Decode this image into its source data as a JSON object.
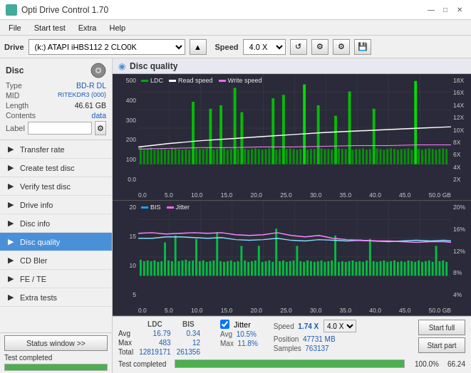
{
  "app": {
    "title": "Opti Drive Control 1.70",
    "icon_color": "#4a9a6a"
  },
  "titlebar": {
    "title": "Opti Drive Control 1.70",
    "minimize": "—",
    "maximize": "□",
    "close": "✕"
  },
  "menubar": {
    "items": [
      "File",
      "Start test",
      "Extra",
      "Help"
    ]
  },
  "toolbar": {
    "drive_label": "Drive",
    "drive_value": "(k:) ATAPI iHBS112  2 CLO0K",
    "speed_label": "Speed",
    "speed_value": "4.0 X"
  },
  "disc": {
    "section_title": "Disc",
    "type_label": "Type",
    "type_value": "BD-R DL",
    "mid_label": "MID",
    "mid_value": "RITEKDR3 (000)",
    "length_label": "Length",
    "length_value": "46.61 GB",
    "contents_label": "Contents",
    "contents_value": "data",
    "label_label": "Label",
    "label_input_placeholder": ""
  },
  "nav": {
    "items": [
      {
        "id": "transfer-rate",
        "label": "Transfer rate",
        "active": false
      },
      {
        "id": "create-test-disc",
        "label": "Create test disc",
        "active": false
      },
      {
        "id": "verify-test-disc",
        "label": "Verify test disc",
        "active": false
      },
      {
        "id": "drive-info",
        "label": "Drive info",
        "active": false
      },
      {
        "id": "disc-info",
        "label": "Disc info",
        "active": false
      },
      {
        "id": "disc-quality",
        "label": "Disc quality",
        "active": true
      },
      {
        "id": "cd-bler",
        "label": "CD Bler",
        "active": false
      },
      {
        "id": "fe-te",
        "label": "FE / TE",
        "active": false
      },
      {
        "id": "extra-tests",
        "label": "Extra tests",
        "active": false
      }
    ]
  },
  "status": {
    "btn_label": "Status window >>",
    "progress_text": "Test completed",
    "progress_value": 100
  },
  "chart": {
    "title": "Disc quality",
    "top": {
      "legend": [
        {
          "label": "LDC",
          "color": "#00aa00"
        },
        {
          "label": "Read speed",
          "color": "#ffffff"
        },
        {
          "label": "Write speed",
          "color": "#ff66ff"
        }
      ],
      "y_left": [
        "500",
        "400",
        "300",
        "200",
        "100",
        "0.0"
      ],
      "y_right": [
        "18X",
        "16X",
        "14X",
        "12X",
        "10X",
        "8X",
        "6X",
        "4X",
        "2X"
      ],
      "x_labels": [
        "0.0",
        "5.0",
        "10.0",
        "15.0",
        "20.0",
        "25.0",
        "30.0",
        "35.0",
        "40.0",
        "45.0",
        "50.0 GB"
      ]
    },
    "bottom": {
      "legend": [
        {
          "label": "BIS",
          "color": "#00aaff"
        },
        {
          "label": "Jitter",
          "color": "#ff66ff"
        }
      ],
      "y_left": [
        "20",
        "15",
        "10",
        "5"
      ],
      "y_right": [
        "20%",
        "16%",
        "12%",
        "8%",
        "4%"
      ],
      "x_labels": [
        "0.0",
        "5.0",
        "10.0",
        "15.0",
        "20.0",
        "25.0",
        "30.0",
        "35.0",
        "40.0",
        "45.0",
        "50.0 GB"
      ]
    }
  },
  "stats": {
    "columns": [
      "",
      "LDC",
      "BIS",
      "",
      "Jitter",
      "Speed",
      ""
    ],
    "avg_label": "Avg",
    "avg_ldc": "16.79",
    "avg_bis": "0.34",
    "avg_jitter": "10.5%",
    "max_label": "Max",
    "max_ldc": "483",
    "max_bis": "12",
    "max_jitter": "11.8%",
    "total_label": "Total",
    "total_ldc": "12819171",
    "total_bis": "261356",
    "speed_label": "Speed",
    "speed_value": "1.74 X",
    "speed_select": "4.0 X",
    "position_label": "Position",
    "position_value": "47731 MB",
    "samples_label": "Samples",
    "samples_value": "763137",
    "start_full_label": "Start full",
    "start_part_label": "Start part",
    "jitter_checked": true,
    "progress_label": "Test completed",
    "progress_value": "100.0%",
    "time_value": "66.24"
  }
}
